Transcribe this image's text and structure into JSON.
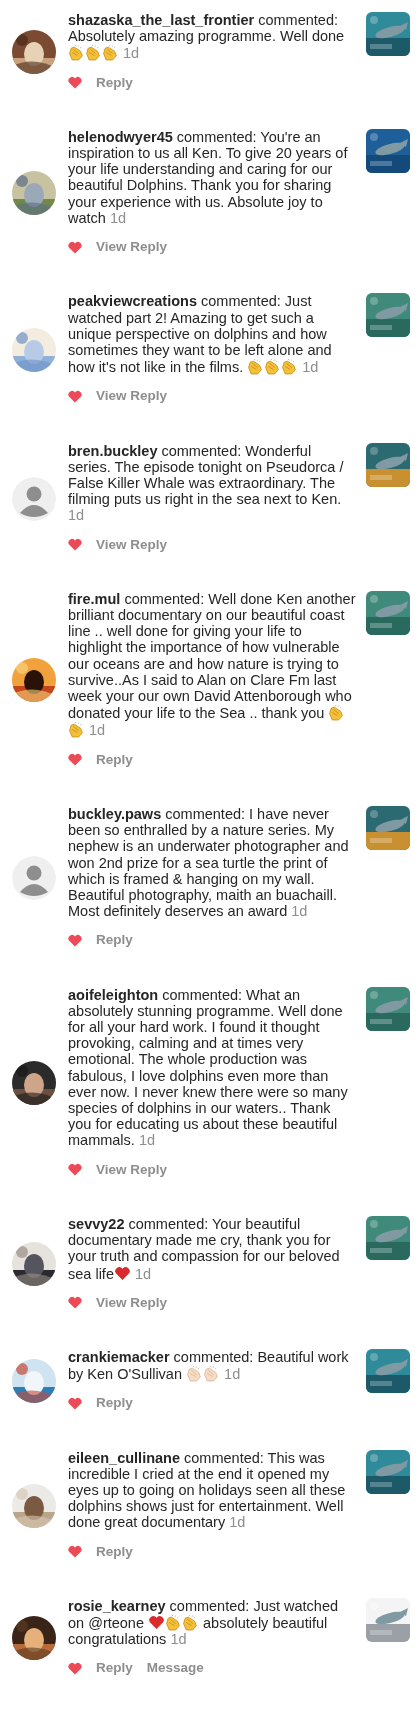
{
  "comments": [
    {
      "avatar": {
        "kind": "picture"
      },
      "username": "shazaska_the_last_frontier",
      "body": [
        {
          "kind": "text",
          "text": " commented: Absolutely amazing programme. Well done "
        },
        {
          "kind": "clap"
        },
        {
          "kind": "clap"
        },
        {
          "kind": "clap"
        }
      ],
      "time": "1d",
      "liked": true,
      "actions": [
        "Reply"
      ],
      "thumbnail": {
        "kind": "picture"
      }
    },
    {
      "avatar": {
        "kind": "picture"
      },
      "username": "helenodwyer45",
      "body": [
        {
          "kind": "text",
          "text": " commented: You're an inspiration to us all Ken. To give 20 years of your life understanding and caring for our beautiful Dolphins. Thank you for sharing your experience with us. Absolute joy to watch"
        }
      ],
      "time": "1d",
      "liked": true,
      "actions": [
        "View Reply"
      ],
      "thumbnail": {
        "kind": "picture"
      }
    },
    {
      "avatar": {
        "kind": "picture"
      },
      "username": "peakviewcreations",
      "body": [
        {
          "kind": "text",
          "text": " commented: Just watched part 2! Amazing to get such a unique perspective on dolphins and how sometimes they want to be left alone and how it's not like in the films. "
        },
        {
          "kind": "clap"
        },
        {
          "kind": "clap"
        },
        {
          "kind": "clap"
        }
      ],
      "time": "1d",
      "liked": true,
      "actions": [
        "View Reply"
      ],
      "thumbnail": {
        "kind": "picture"
      }
    },
    {
      "avatar": {
        "kind": "default"
      },
      "username": "bren.buckley",
      "body": [
        {
          "kind": "text",
          "text": " commented: Wonderful series. The episode tonight on Pseudorca / False Killer Whale was extraordinary. The filming puts us right in the sea next to Ken. "
        }
      ],
      "time": "1d",
      "liked": true,
      "actions": [
        "View Reply"
      ],
      "thumbnail": {
        "kind": "picture"
      }
    },
    {
      "avatar": {
        "kind": "picture"
      },
      "username": "fire.mul",
      "body": [
        {
          "kind": "text",
          "text": " commented: Well done Ken another brilliant documentary on our beautiful coast line .. well done for giving your life to highlight the importance of how vulnerable our oceans are and how nature is trying to survive..As I said to Alan on Clare Fm last week your our own David Attenborough who donated your life to the Sea .. thank you "
        },
        {
          "kind": "clap"
        },
        {
          "kind": "clap"
        }
      ],
      "time": "1d",
      "liked": true,
      "actions": [
        "Reply"
      ],
      "thumbnail": {
        "kind": "picture"
      }
    },
    {
      "avatar": {
        "kind": "default"
      },
      "username": "buckley.paws",
      "body": [
        {
          "kind": "text",
          "text": " commented: I have never been so enthralled by a nature series. My nephew is an underwater photographer and won 2nd prize for a sea turtle the print of which is framed & hanging on my wall. Beautiful photography, maith an buachaill. Most definitely deserves an award"
        }
      ],
      "time": "1d",
      "liked": true,
      "actions": [
        "Reply"
      ],
      "thumbnail": {
        "kind": "picture"
      }
    },
    {
      "avatar": {
        "kind": "picture"
      },
      "username": "aoifeleighton",
      "body": [
        {
          "kind": "text",
          "text": " commented: What an absolutely stunning programme. Well done for all your hard work.  I found it thought provoking, calming and at times very emotional.  The whole production was fabulous,  I love dolphins even more than ever now.  I never knew there were so many species of dolphins in our waters.. Thank you for educating us about these beautiful mammals."
        }
      ],
      "time": "1d",
      "liked": true,
      "actions": [
        "View Reply"
      ],
      "thumbnail": {
        "kind": "picture"
      }
    },
    {
      "avatar": {
        "kind": "picture"
      },
      "username": "sevvy22",
      "body": [
        {
          "kind": "text",
          "text": " commented: Your beautiful documentary made me cry, thank you for your truth and compassion for our beloved sea life"
        },
        {
          "kind": "heart"
        }
      ],
      "time": "1d",
      "liked": true,
      "actions": [
        "View Reply"
      ],
      "thumbnail": {
        "kind": "picture"
      }
    },
    {
      "avatar": {
        "kind": "picture"
      },
      "username": "crankiemacker",
      "body": [
        {
          "kind": "text",
          "text": " commented: Beautiful work by Ken O'Sullivan "
        },
        {
          "kind": "clap-light"
        },
        {
          "kind": "clap-light"
        }
      ],
      "time": "1d",
      "liked": true,
      "actions": [
        "Reply"
      ],
      "thumbnail": {
        "kind": "picture"
      }
    },
    {
      "avatar": {
        "kind": "picture"
      },
      "username": "eileen_cullinane",
      "body": [
        {
          "kind": "text",
          "text": " commented: This was incredible I cried at the end it opened my eyes up to going on holidays seen all these dolphins shows just for entertainment. Well done great documentary"
        }
      ],
      "time": "1d",
      "liked": true,
      "actions": [
        "Reply"
      ],
      "thumbnail": {
        "kind": "picture"
      }
    },
    {
      "avatar": {
        "kind": "picture"
      },
      "username": "rosie_kearney",
      "body": [
        {
          "kind": "text",
          "text": " commented: Just watched on @rteone "
        },
        {
          "kind": "heart"
        },
        {
          "kind": "clap"
        },
        {
          "kind": "clap"
        },
        {
          "kind": "text",
          "text": " absolutely beautiful congratulations"
        }
      ],
      "time": "1d",
      "liked": true,
      "actions": [
        "Reply",
        "Message"
      ],
      "thumbnail": {
        "kind": "picture"
      }
    }
  ]
}
